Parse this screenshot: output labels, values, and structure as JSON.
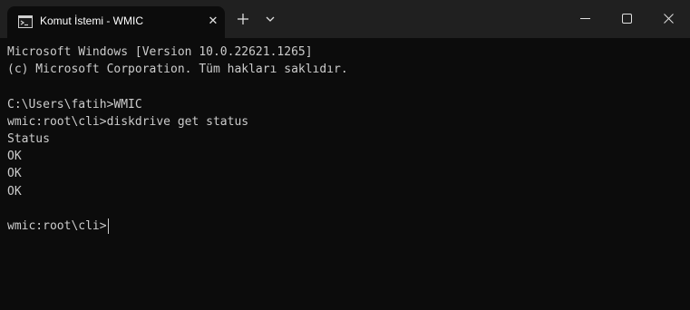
{
  "window": {
    "tab_title": "Komut İstemi - WMIC",
    "tab_icon": "cmd-icon",
    "controls": [
      "minimize-icon",
      "maximize-icon",
      "close-icon"
    ]
  },
  "console": {
    "lines": [
      "Microsoft Windows [Version 10.0.22621.1265]",
      "(c) Microsoft Corporation. Tüm hakları saklıdır.",
      "",
      "C:\\Users\\fatih>WMIC",
      "wmic:root\\cli>diskdrive get status",
      "Status",
      "OK",
      "OK",
      "OK",
      ""
    ],
    "prompt": "wmic:root\\cli>"
  },
  "colors": {
    "titlebar": "#202020",
    "background": "#0c0c0c",
    "text": "#cccccc"
  }
}
